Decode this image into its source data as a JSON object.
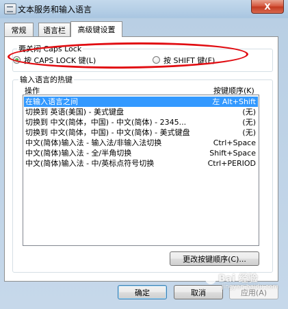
{
  "window": {
    "title": "文本服务和输入语言",
    "close_glyph": "X"
  },
  "tabs": [
    {
      "label": "常规"
    },
    {
      "label": "语言栏"
    },
    {
      "label": "高级键设置"
    }
  ],
  "caps_group": {
    "title": "要关闭 Caps Lock",
    "options": [
      {
        "label": "按 CAPS LOCK 键(L)",
        "checked": true
      },
      {
        "label": "按 SHIFT 键(F)",
        "checked": false
      }
    ]
  },
  "hotkeys_group": {
    "title": "输入语言的热键",
    "col_action": "操作",
    "col_key": "按键顺序(K)",
    "rows": [
      {
        "action": "在输入语言之间",
        "key": "左 Alt+Shift",
        "selected": true
      },
      {
        "action": "切换到 英语(美国) - 美式键盘",
        "key": "(无)",
        "selected": false
      },
      {
        "action": "切换到 中文(简体，中国) - 中文(简体) - 2345...",
        "key": "(无)",
        "selected": false
      },
      {
        "action": "切换到 中文(简体，中国) - 中文(简体) - 美式键盘",
        "key": "(无)",
        "selected": false
      },
      {
        "action": "中文(简体)输入法 - 输入法/非输入法切换",
        "key": "Ctrl+Space",
        "selected": false
      },
      {
        "action": "中文(简体)输入法 - 全/半角切换",
        "key": "Shift+Space",
        "selected": false
      },
      {
        "action": "中文(简体)输入法 - 中/英标点符号切换",
        "key": "Ctrl+PERIOD",
        "selected": false
      }
    ],
    "change_button": "更改按键顺序(C)..."
  },
  "footer": {
    "ok": "确定",
    "cancel": "取消",
    "apply": "应用(A)"
  },
  "watermark": {
    "text": "Bai 经验",
    "sub": "jingyan.baidu.com"
  },
  "colors": {
    "selection": "#3399ff",
    "annotation": "#e10d12",
    "radio_dot": "#1c7a1c"
  }
}
